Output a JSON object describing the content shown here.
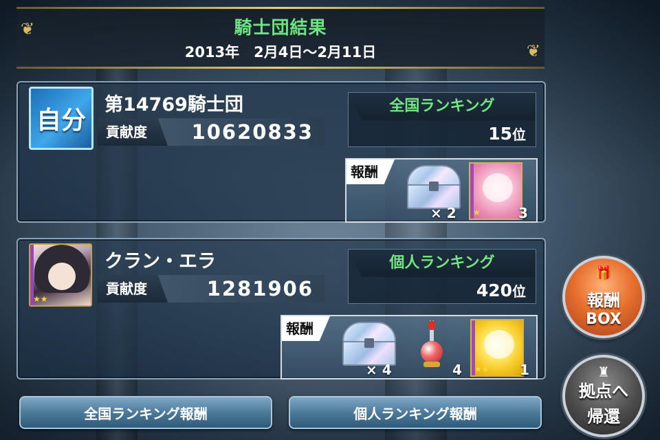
{
  "header": {
    "title": "騎士団結果",
    "period": "2013年　2月4日〜2月11日"
  },
  "knight_order": {
    "badge": "自分",
    "name": "第14769騎士団",
    "contribution_label": "貢献度",
    "contribution_value": "10620833",
    "ranking_title": "全国ランキング",
    "ranking_value": "15",
    "ranking_suffix": "位",
    "reward_label": "報酬",
    "rewards": [
      {
        "icon": "treasure-chest-icon",
        "qty": "× 2"
      },
      {
        "icon": "pink-character-card-icon",
        "qty": "3"
      }
    ]
  },
  "player": {
    "name": "クラン・エラ",
    "contribution_label": "貢献度",
    "contribution_value": "1281906",
    "ranking_title": "個人ランキング",
    "ranking_value": "420",
    "ranking_suffix": "位",
    "reward_label": "報酬",
    "rewards": [
      {
        "icon": "treasure-chest-icon",
        "qty": "× 4"
      },
      {
        "icon": "red-potion-icon",
        "qty": "4"
      },
      {
        "icon": "yellow-character-card-icon",
        "qty": "1"
      }
    ]
  },
  "buttons": {
    "national_reward": "全国ランキング報酬",
    "personal_reward": "個人ランキング報酬",
    "reward_box_line1": "報酬",
    "reward_box_line2": "BOX",
    "return_line1": "拠点へ",
    "return_line2": "帰還"
  },
  "colors": {
    "title_green": "#6ee27e",
    "gold_trim": "#d9bb62",
    "reward_box_orange": "#e8702f"
  }
}
